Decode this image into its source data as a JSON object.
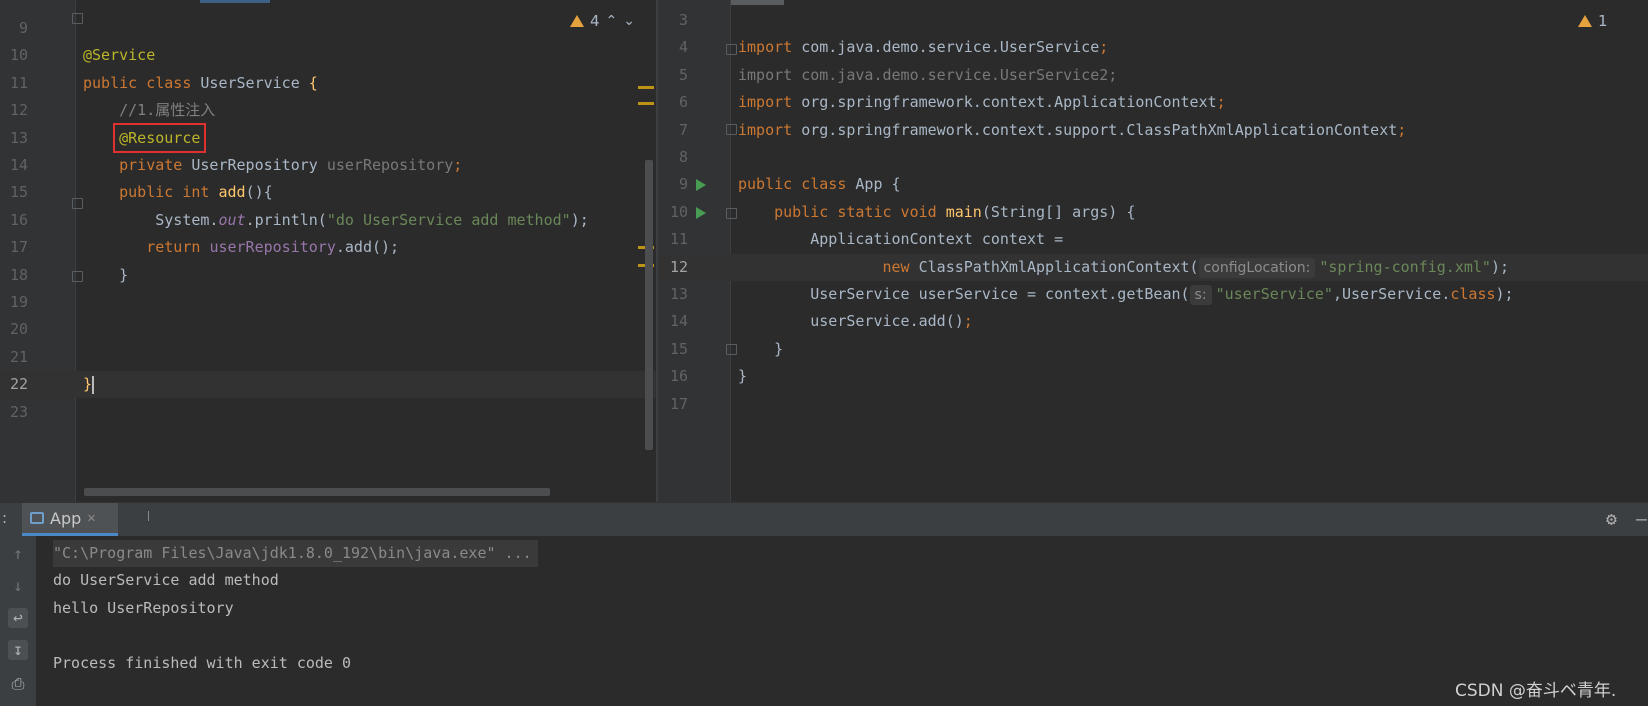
{
  "left_editor": {
    "warnings": {
      "count": "4",
      "up_icon": "chevron-up-icon",
      "down_icon": "chevron-down-icon"
    },
    "lines": [
      {
        "num": "9",
        "tokens": []
      },
      {
        "num": "10",
        "tokens": [
          {
            "t": "@Service",
            "c": "ann"
          }
        ]
      },
      {
        "num": "11",
        "tokens": [
          {
            "t": "public class ",
            "c": "kw"
          },
          {
            "t": "UserService ",
            "c": ""
          },
          {
            "t": "{",
            "c": "mth"
          }
        ]
      },
      {
        "num": "12",
        "tokens": [
          {
            "t": "    //1.属性注入",
            "c": "cmt"
          }
        ]
      },
      {
        "num": "13",
        "tokens": [
          {
            "t": "    ",
            "c": ""
          },
          {
            "t": "@Resource",
            "c": "ann",
            "box": true
          }
        ]
      },
      {
        "num": "14",
        "tokens": [
          {
            "t": "    private ",
            "c": "kw"
          },
          {
            "t": "UserRepository ",
            "c": ""
          },
          {
            "t": "userRepository",
            "c": "gray"
          },
          {
            "t": ";",
            "c": "kw"
          }
        ]
      },
      {
        "num": "15",
        "tokens": [
          {
            "t": "    public int ",
            "c": "kw"
          },
          {
            "t": "add",
            "c": "mth"
          },
          {
            "t": "(){",
            "c": ""
          }
        ]
      },
      {
        "num": "16",
        "tokens": [
          {
            "t": "        System.",
            "c": ""
          },
          {
            "t": "out",
            "c": "ital"
          },
          {
            "t": ".println(",
            "c": ""
          },
          {
            "t": "\"do UserService add method\"",
            "c": "str"
          },
          {
            "t": ");",
            "c": ""
          }
        ]
      },
      {
        "num": "17",
        "tokens": [
          {
            "t": "       return ",
            "c": "kw"
          },
          {
            "t": "userRepository",
            "c": "fld"
          },
          {
            "t": ".add();",
            "c": ""
          }
        ]
      },
      {
        "num": "18",
        "tokens": [
          {
            "t": "    }",
            "c": ""
          }
        ]
      },
      {
        "num": "19",
        "tokens": []
      },
      {
        "num": "20",
        "tokens": []
      },
      {
        "num": "21",
        "tokens": []
      },
      {
        "num": "22",
        "tokens": [
          {
            "t": "}",
            "c": "mth"
          }
        ],
        "current": true
      },
      {
        "num": "23",
        "tokens": []
      }
    ]
  },
  "right_editor": {
    "warnings": {
      "count": "1"
    },
    "lines": [
      {
        "num": "3",
        "tokens": []
      },
      {
        "num": "4",
        "tokens": [
          {
            "t": "import ",
            "c": "kw"
          },
          {
            "t": "com.java.demo.service.UserService",
            "c": ""
          },
          {
            "t": ";",
            "c": "kw"
          }
        ]
      },
      {
        "num": "5",
        "tokens": [
          {
            "t": "import com.java.demo.service.UserService2;",
            "c": "gray"
          }
        ]
      },
      {
        "num": "6",
        "tokens": [
          {
            "t": "import ",
            "c": "kw"
          },
          {
            "t": "org.springframework.context.ApplicationContext",
            "c": ""
          },
          {
            "t": ";",
            "c": "kw"
          }
        ]
      },
      {
        "num": "7",
        "tokens": [
          {
            "t": "import ",
            "c": "kw"
          },
          {
            "t": "org.springframework.context.support.ClassPathXmlApplicationContext",
            "c": ""
          },
          {
            "t": ";",
            "c": "kw"
          }
        ]
      },
      {
        "num": "8",
        "tokens": []
      },
      {
        "num": "9",
        "tokens": [
          {
            "t": "public class ",
            "c": "kw"
          },
          {
            "t": "App {",
            "c": ""
          }
        ],
        "run": true
      },
      {
        "num": "10",
        "tokens": [
          {
            "t": "    public static void ",
            "c": "kw"
          },
          {
            "t": "main",
            "c": "mth"
          },
          {
            "t": "(String[] args) {",
            "c": ""
          }
        ],
        "run": true
      },
      {
        "num": "11",
        "tokens": [
          {
            "t": "        ApplicationContext context =",
            "c": ""
          }
        ]
      },
      {
        "num": "12",
        "tokens": [
          {
            "t": "                ",
            "c": ""
          },
          {
            "t": "new ",
            "c": "kw"
          },
          {
            "t": "ClassPathXmlApplicationContext(",
            "c": ""
          },
          {
            "t": "configLocation:",
            "c": "hint"
          },
          {
            "t": "\"spring-config.xml\"",
            "c": "str"
          },
          {
            "t": ");",
            "c": ""
          }
        ],
        "current": true
      },
      {
        "num": "13",
        "tokens": [
          {
            "t": "        UserService userService = context.getBean(",
            "c": ""
          },
          {
            "t": "s:",
            "c": "hint"
          },
          {
            "t": "\"userService\"",
            "c": "str"
          },
          {
            "t": ",UserService.",
            "c": ""
          },
          {
            "t": "class",
            "c": "kw"
          },
          {
            "t": ");",
            "c": ""
          }
        ]
      },
      {
        "num": "14",
        "tokens": [
          {
            "t": "        userService.add()",
            "c": ""
          },
          {
            "t": ";",
            "c": "kw"
          }
        ]
      },
      {
        "num": "15",
        "tokens": [
          {
            "t": "    }",
            "c": ""
          }
        ]
      },
      {
        "num": "16",
        "tokens": [
          {
            "t": "}",
            "c": ""
          }
        ]
      },
      {
        "num": "17",
        "tokens": []
      }
    ]
  },
  "run_panel": {
    "tab_label": "App",
    "tab_icon": "run-config-icon",
    "close_icon": "close-icon",
    "settings_icon": "gear-icon",
    "minimize_icon": "minimize-icon",
    "console": [
      {
        "text": "\"C:\\Program Files\\Java\\jdk1.8.0_192\\bin\\java.exe\" ...",
        "style": "cmd"
      },
      {
        "text": "do UserService add method",
        "style": "out"
      },
      {
        "text": "hello UserRepository",
        "style": "out"
      },
      {
        "text": "",
        "style": "out"
      },
      {
        "text": "Process finished with exit code 0",
        "style": "out"
      }
    ]
  },
  "watermark": "CSDN @奋斗ベ青年."
}
